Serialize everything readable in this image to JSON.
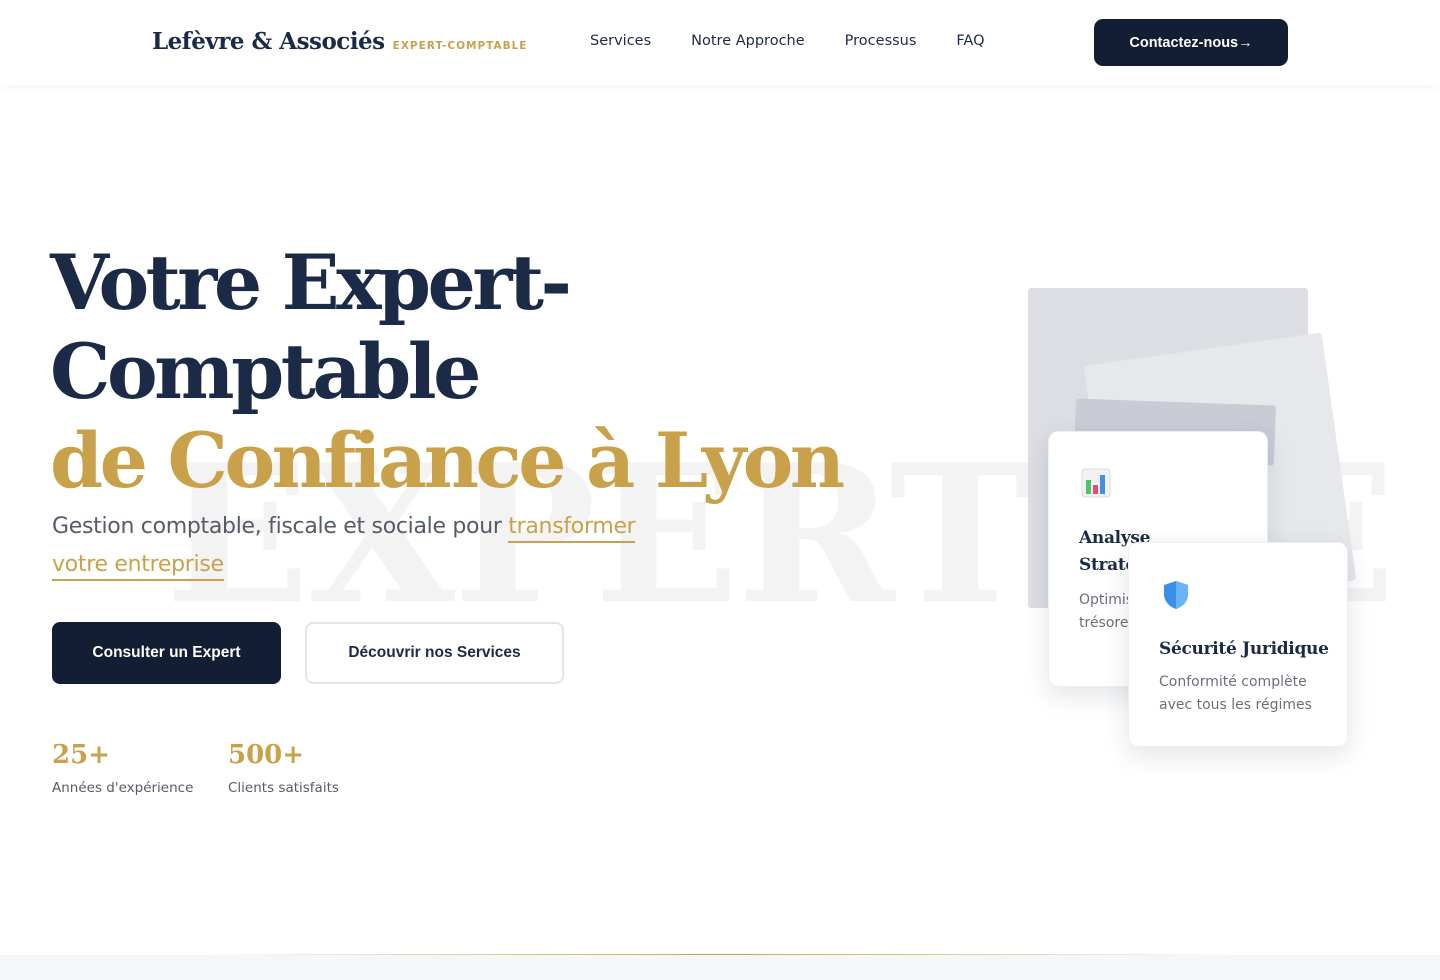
{
  "header": {
    "logo_name": "Lefèvre & Associés",
    "logo_tag": "EXPERT-COMPTABLE",
    "nav": [
      {
        "label": "Services"
      },
      {
        "label": "Notre Approche"
      },
      {
        "label": "Processus"
      },
      {
        "label": "FAQ"
      }
    ],
    "contact_label": "Contactez-nous→"
  },
  "hero": {
    "watermark": "EXPERTISE",
    "title_line1": "Votre Expert-",
    "title_line2": "Comptable",
    "title_line3": "de Confiance à Lyon",
    "subtitle_start": "Gestion comptable, fiscale et sociale pour ",
    "subtitle_highlight1": "transformer",
    "subtitle_highlight2": "votre entreprise",
    "primary_button": "Consulter un Expert",
    "secondary_button": "Découvrir nos Services",
    "stats": [
      {
        "value": "25+",
        "label": "Années d'expérience"
      },
      {
        "value": "500+",
        "label": "Clients satisfaits"
      }
    ]
  },
  "cards": [
    {
      "icon": "bar-chart-icon",
      "title": "Analyse Stratégique",
      "desc": "Optimisation fiscalité et trésorerie"
    },
    {
      "icon": "shield-icon",
      "title": "Sécurité Juridique",
      "desc": "Conformité complète avec tous les régimes"
    }
  ],
  "colors": {
    "navy": "#131d33",
    "gold": "#c9a14a",
    "text": "#1b2a47"
  }
}
